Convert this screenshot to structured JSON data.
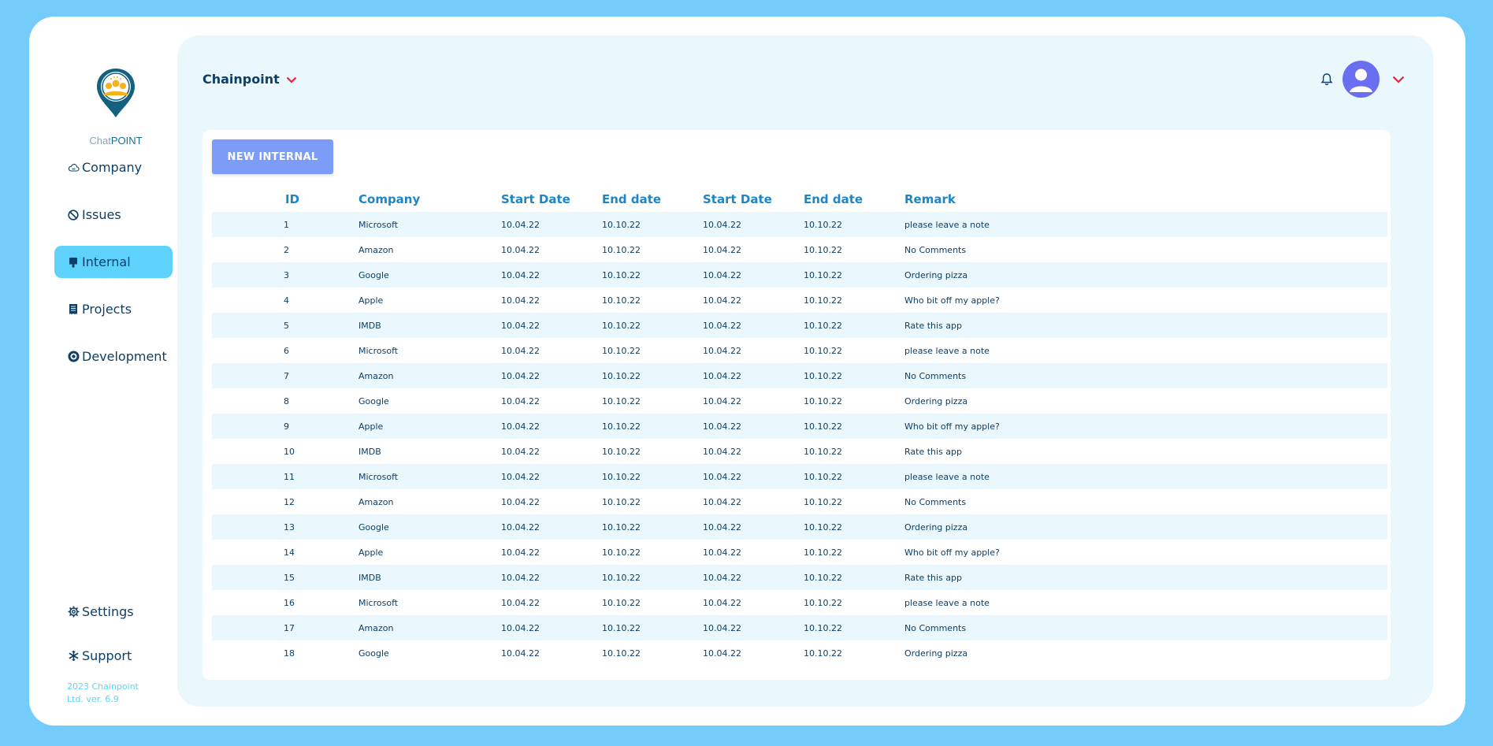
{
  "app": {
    "logo_prefix": "Chat",
    "logo_suffix": "POINT",
    "company_selector": "Chainpoint",
    "new_button": "NEW INTERNAL",
    "footer_line1": "2023 Chainpoint",
    "footer_line2": "Ltd. ver. 6.9"
  },
  "colors": {
    "background": "#74ccfb",
    "accent": "#5ed2fb",
    "primary_button": "#7d9cf7",
    "header_text": "#1b86c8",
    "chevron": "#e8243a",
    "avatar": "#6a6ff2"
  },
  "sidebar": {
    "items": [
      {
        "label": "Company",
        "icon": "cloud-icon",
        "active": false
      },
      {
        "label": "Issues",
        "icon": "block-icon",
        "active": false
      },
      {
        "label": "Internal",
        "icon": "brush-icon",
        "active": true
      },
      {
        "label": "Projects",
        "icon": "receipt-icon",
        "active": false
      },
      {
        "label": "Development",
        "icon": "target-icon",
        "active": false
      }
    ],
    "bottom_items": [
      {
        "label": "Settings",
        "icon": "gear-icon"
      },
      {
        "label": "Support",
        "icon": "snowflake-icon"
      }
    ]
  },
  "table": {
    "headers": [
      "ID",
      "Company",
      "Start Date",
      "End date",
      "Start Date",
      "End date",
      "Remark"
    ],
    "rows": [
      [
        "1",
        "Microsoft",
        "10.04.22",
        "10.10.22",
        "10.04.22",
        "10.10.22",
        "please leave a note"
      ],
      [
        "2",
        "Amazon",
        "10.04.22",
        "10.10.22",
        "10.04.22",
        "10.10.22",
        "No Comments"
      ],
      [
        "3",
        "Google",
        "10.04.22",
        "10.10.22",
        "10.04.22",
        "10.10.22",
        "Ordering pizza"
      ],
      [
        "4",
        "Apple",
        "10.04.22",
        "10.10.22",
        "10.04.22",
        "10.10.22",
        "Who bit off my apple?"
      ],
      [
        "5",
        "IMDB",
        "10.04.22",
        "10.10.22",
        "10.04.22",
        "10.10.22",
        "Rate this app"
      ],
      [
        "6",
        "Microsoft",
        "10.04.22",
        "10.10.22",
        "10.04.22",
        "10.10.22",
        "please leave a note"
      ],
      [
        "7",
        "Amazon",
        "10.04.22",
        "10.10.22",
        "10.04.22",
        "10.10.22",
        "No Comments"
      ],
      [
        "8",
        "Google",
        "10.04.22",
        "10.10.22",
        "10.04.22",
        "10.10.22",
        "Ordering pizza"
      ],
      [
        "9",
        "Apple",
        "10.04.22",
        "10.10.22",
        "10.04.22",
        "10.10.22",
        "Who bit off my apple?"
      ],
      [
        "10",
        "IMDB",
        "10.04.22",
        "10.10.22",
        "10.04.22",
        "10.10.22",
        "Rate this app"
      ],
      [
        "11",
        "Microsoft",
        "10.04.22",
        "10.10.22",
        "10.04.22",
        "10.10.22",
        "please leave a note"
      ],
      [
        "12",
        "Amazon",
        "10.04.22",
        "10.10.22",
        "10.04.22",
        "10.10.22",
        "No Comments"
      ],
      [
        "13",
        "Google",
        "10.04.22",
        "10.10.22",
        "10.04.22",
        "10.10.22",
        "Ordering pizza"
      ],
      [
        "14",
        "Apple",
        "10.04.22",
        "10.10.22",
        "10.04.22",
        "10.10.22",
        "Who bit off my apple?"
      ],
      [
        "15",
        "IMDB",
        "10.04.22",
        "10.10.22",
        "10.04.22",
        "10.10.22",
        "Rate this app"
      ],
      [
        "16",
        "Microsoft",
        "10.04.22",
        "10.10.22",
        "10.04.22",
        "10.10.22",
        "please leave a note"
      ],
      [
        "17",
        "Amazon",
        "10.04.22",
        "10.10.22",
        "10.04.22",
        "10.10.22",
        "No Comments"
      ],
      [
        "18",
        "Google",
        "10.04.22",
        "10.10.22",
        "10.04.22",
        "10.10.22",
        "Ordering pizza"
      ]
    ]
  }
}
